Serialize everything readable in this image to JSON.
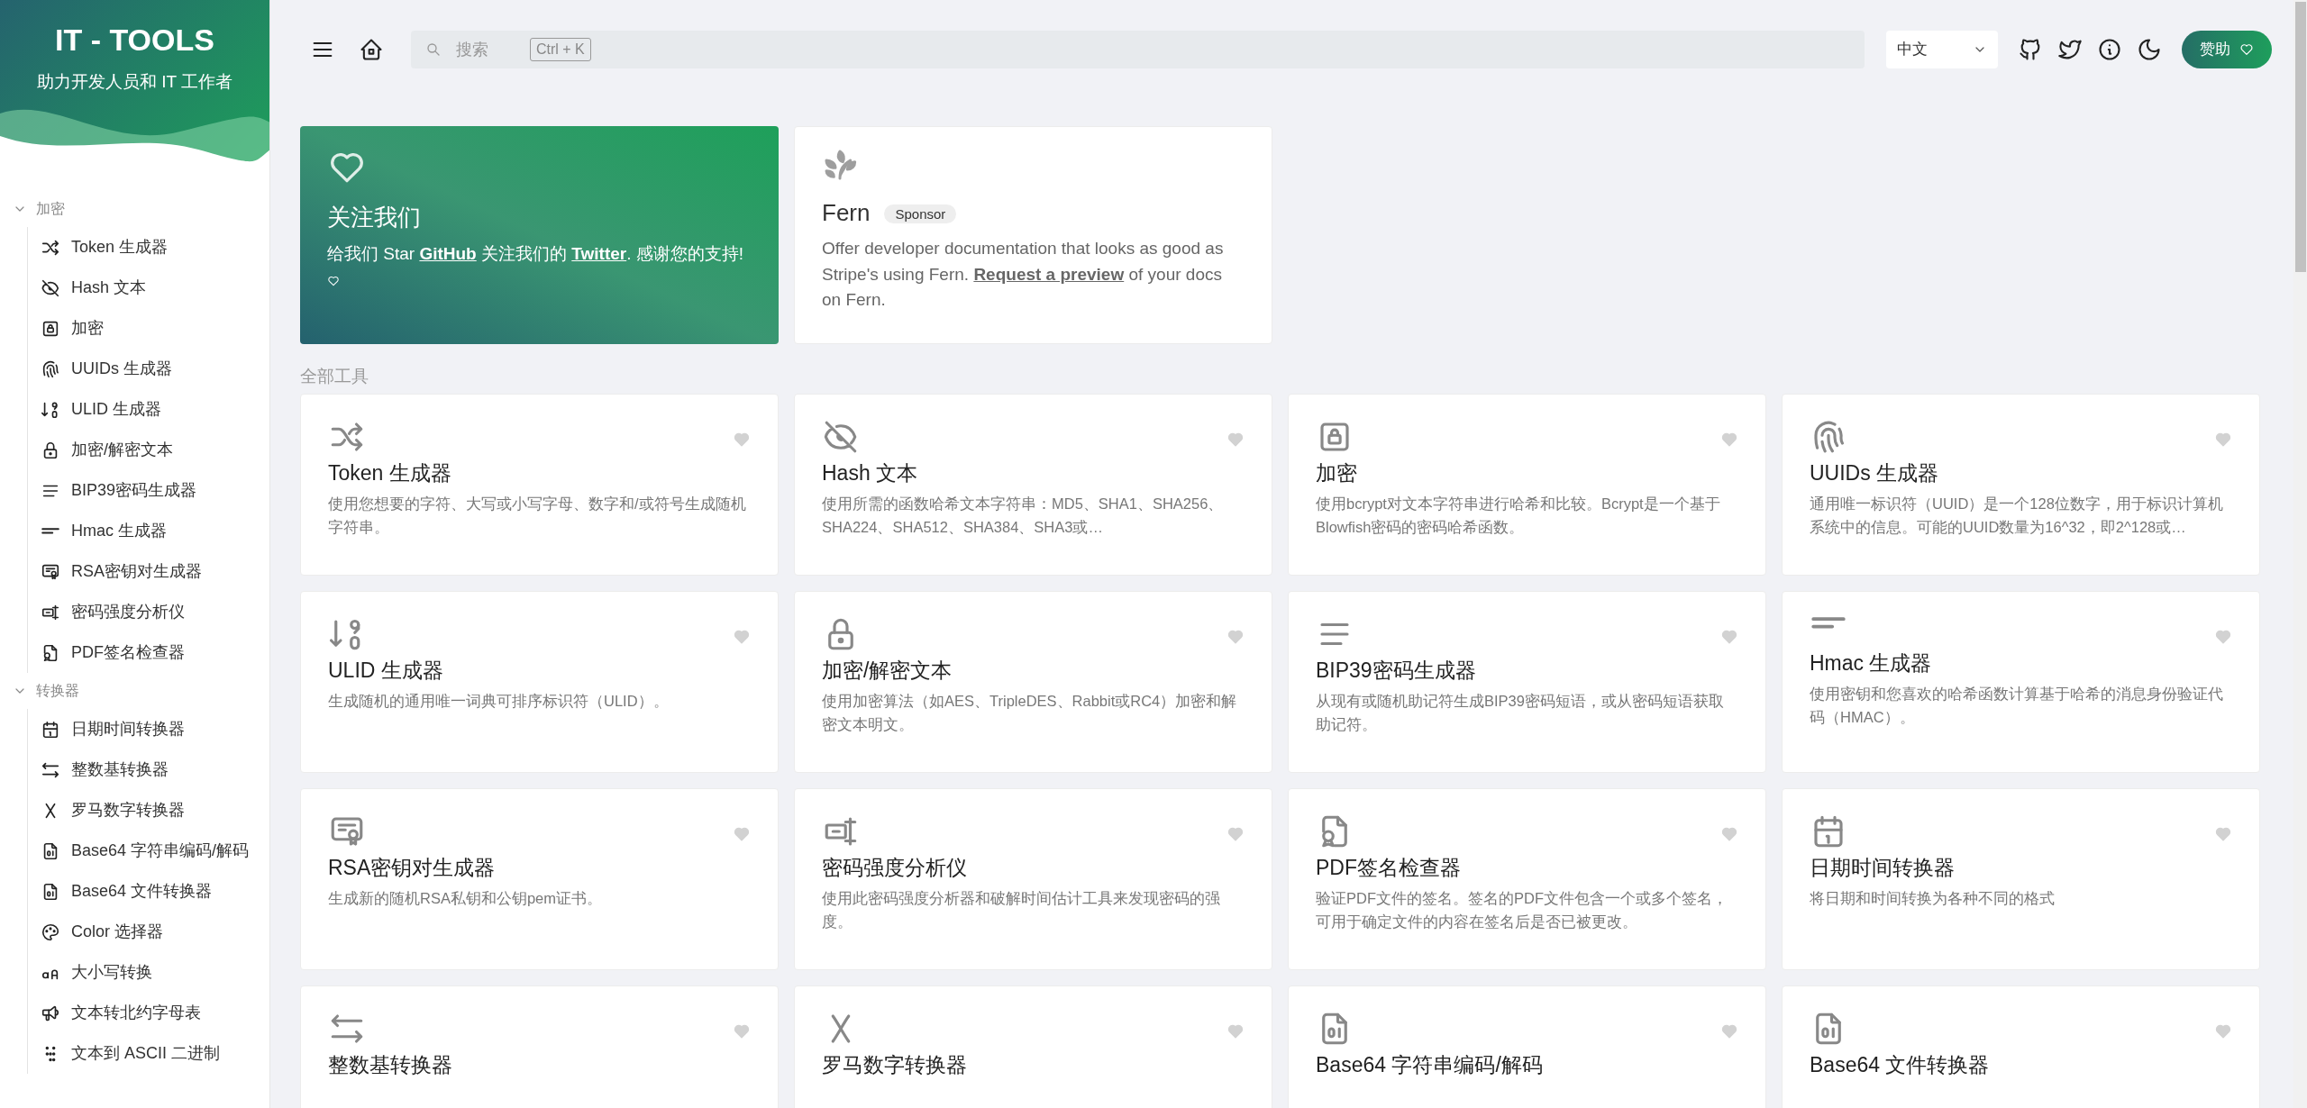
{
  "sidebar": {
    "title": "IT - TOOLS",
    "subtitle": "助力开发人员和 IT 工作者",
    "groups": [
      {
        "label": "加密",
        "expanded": true,
        "items": [
          {
            "label": "Token 生成器"
          },
          {
            "label": "Hash 文本"
          },
          {
            "label": "加密"
          },
          {
            "label": "UUIDs 生成器"
          },
          {
            "label": "ULID 生成器"
          },
          {
            "label": "加密/解密文本"
          },
          {
            "label": "BIP39密码生成器"
          },
          {
            "label": "Hmac 生成器"
          },
          {
            "label": "RSA密钥对生成器"
          },
          {
            "label": "密码强度分析仪"
          },
          {
            "label": "PDF签名检查器"
          }
        ]
      },
      {
        "label": "转换器",
        "expanded": true,
        "items": [
          {
            "label": "日期时间转换器"
          },
          {
            "label": "整数基转换器"
          },
          {
            "label": "罗马数字转换器"
          },
          {
            "label": "Base64 字符串编码/解码"
          },
          {
            "label": "Base64 文件转换器"
          },
          {
            "label": "Color 选择器"
          },
          {
            "label": "大小写转换"
          },
          {
            "label": "文本转北约字母表"
          },
          {
            "label": "文本到 ASCII 二进制"
          }
        ]
      }
    ]
  },
  "header": {
    "search": {
      "placeholder": "搜索",
      "shortcut": "Ctrl + K"
    },
    "language": "中文",
    "sponsor_button": "赞助"
  },
  "follow_card": {
    "title": "关注我们",
    "message": [
      {
        "kind": "text",
        "text": "给我们 Star "
      },
      {
        "kind": "link",
        "text": "GitHub"
      },
      {
        "kind": "text",
        "text": " 关注我们的 "
      },
      {
        "kind": "link",
        "text": "Twitter"
      },
      {
        "kind": "text",
        "text": ". 感谢您的支持!"
      }
    ]
  },
  "sponsor_card": {
    "title": "Fern",
    "badge": "Sponsor",
    "description": [
      {
        "kind": "text",
        "text": "Offer developer documentation that looks as good as Stripe's using Fern. "
      },
      {
        "kind": "link",
        "text": "Request a preview"
      },
      {
        "kind": "text",
        "text": " of your docs on Fern."
      }
    ]
  },
  "section_label": "全部工具",
  "tools": [
    {
      "title": "Token 生成器",
      "description": "使用您想要的字符、大写或小写字母、数字和/或符号生成随机字符串。"
    },
    {
      "title": "Hash 文本",
      "description": "使用所需的函数哈希文本字符串：MD5、SHA1、SHA256、SHA224、SHA512、SHA384、SHA3或…"
    },
    {
      "title": "加密",
      "description": "使用bcrypt对文本字符串进行哈希和比较。Bcrypt是一个基于Blowfish密码的密码哈希函数。"
    },
    {
      "title": "UUIDs 生成器",
      "description": "通用唯一标识符（UUID）是一个128位数字，用于标识计算机系统中的信息。可能的UUID数量为16^32，即2^128或…"
    },
    {
      "title": "ULID 生成器",
      "description": "生成随机的通用唯一词典可排序标识符（ULID）。"
    },
    {
      "title": "加密/解密文本",
      "description": "使用加密算法（如AES、TripleDES、Rabbit或RC4）加密和解密文本明文。"
    },
    {
      "title": "BIP39密码生成器",
      "description": "从现有或随机助记符生成BIP39密码短语，或从密码短语获取助记符。"
    },
    {
      "title": "Hmac 生成器",
      "description": "使用密钥和您喜欢的哈希函数计算基于哈希的消息身份验证代码（HMAC）。"
    },
    {
      "title": "RSA密钥对生成器",
      "description": "生成新的随机RSA私钥和公钥pem证书。"
    },
    {
      "title": "密码强度分析仪",
      "description": "使用此密码强度分析器和破解时间估计工具来发现密码的强度。"
    },
    {
      "title": "PDF签名检查器",
      "description": "验证PDF文件的签名。签名的PDF文件包含一个或多个签名，可用于确定文件的内容在签名后是否已被更改。"
    },
    {
      "title": "日期时间转换器",
      "description": "将日期和时间转换为各种不同的格式"
    },
    {
      "title": "整数基转换器"
    },
    {
      "title": "罗马数字转换器"
    },
    {
      "title": "Base64 字符串编码/解码"
    },
    {
      "title": "Base64 文件转换器"
    }
  ]
}
